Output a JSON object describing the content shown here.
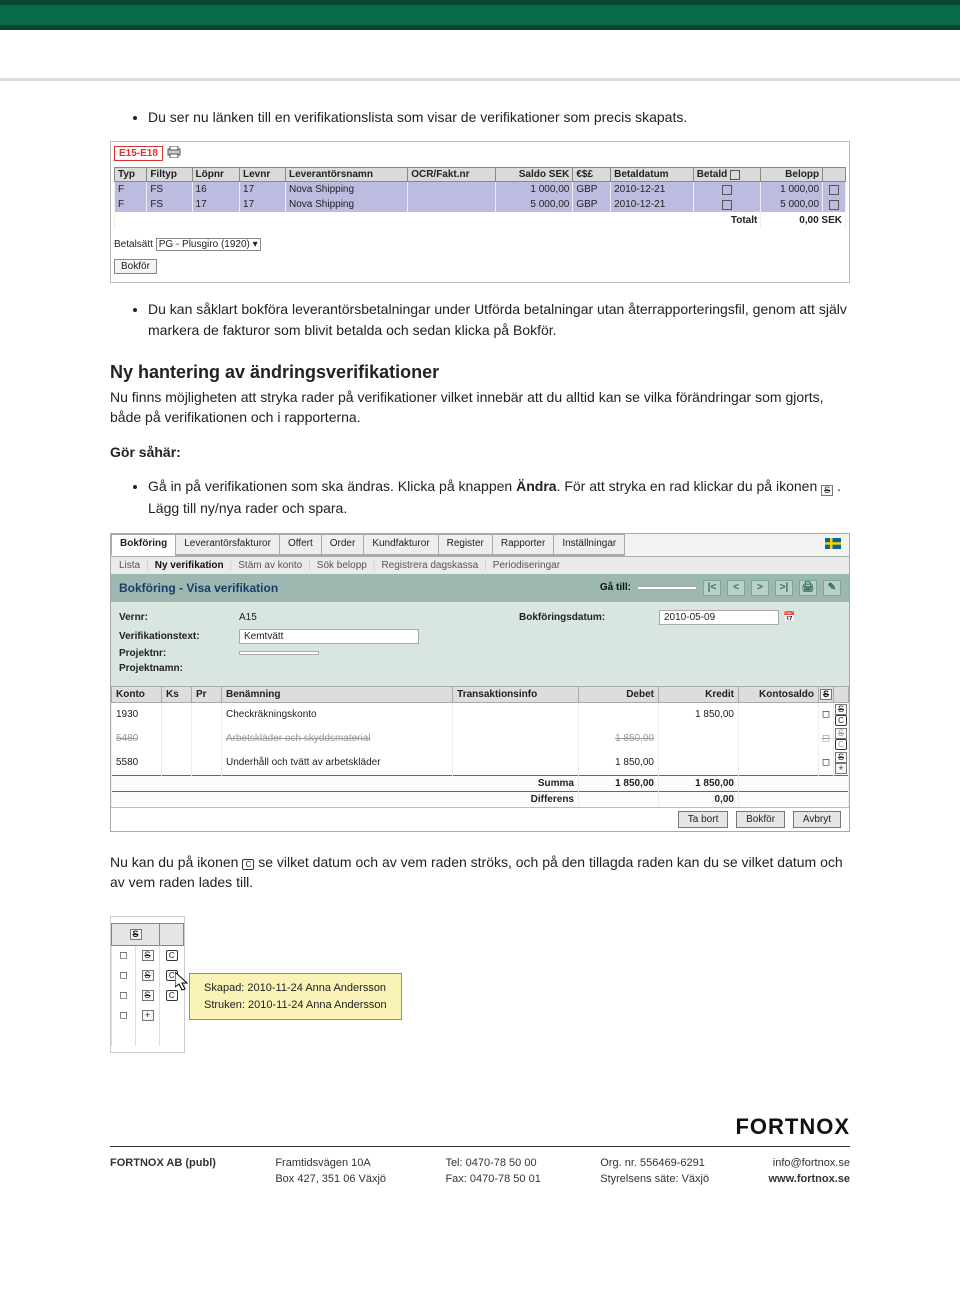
{
  "bullets": {
    "b1": "Du ser nu länken till en verifikationslista som visar de verifikationer som precis skapats.",
    "b2": "Du kan såklart bokföra leverantörsbetalningar under Utförda betalningar utan återrapporteringsfil, genom att själv markera de fakturor som blivit betalda och sedan klicka på Bokför."
  },
  "img1": {
    "link": "E15-E18",
    "headers": {
      "typ": "Typ",
      "filtyp": "Filtyp",
      "lopnr": "Löpnr",
      "levnr": "Levnr",
      "levnamn": "Leverantörsnamn",
      "ocr": "OCR/Fakt.nr",
      "saldo": "Saldo SEK",
      "cur": "€$£",
      "betdatum": "Betaldatum",
      "betald": "Betald",
      "belopp": "Belopp"
    },
    "rows": [
      {
        "typ": "F",
        "filtyp": "FS",
        "lopnr": "16",
        "levnr": "17",
        "levnamn": "Nova Shipping",
        "ocr": "",
        "saldo": "1 000,00",
        "cur": "GBP",
        "betdatum": "2010-12-21",
        "belopp": "1 000,00"
      },
      {
        "typ": "F",
        "filtyp": "FS",
        "lopnr": "17",
        "levnr": "17",
        "levnamn": "Nova Shipping",
        "ocr": "",
        "saldo": "5 000,00",
        "cur": "GBP",
        "betdatum": "2010-12-21",
        "belopp": "5 000,00"
      }
    ],
    "total": {
      "label": "Totalt",
      "value": "0,00  SEK"
    },
    "betalsatt_label": "Betalsätt",
    "betalsatt_value": "PG - Plusgiro (1920)",
    "bokfor_button": "Bokför"
  },
  "section": {
    "title": "Ny hantering av ändringsverifikationer",
    "body": "Nu finns möjligheten att stryka rader på verifikationer vilket innebär att du alltid kan se vilka förändringar som gjorts, både på verifikationen och i rapporterna.",
    "gor_sahar": "Gör såhär:",
    "b3_pre": "Gå in på verifikationen som ska ändras. Klicka på knappen ",
    "b3_bold": "Ändra",
    "b3_mid": ". För att stryka en rad klickar du på ikonen ",
    "b3_post": " . Lägg till ny/nya rader och spara."
  },
  "img2": {
    "tabs": [
      "Bokföring",
      "Leverantörsfakturor",
      "Offert",
      "Order",
      "Kundfakturor",
      "Register",
      "Rapporter",
      "Inställningar"
    ],
    "subtabs": [
      "Lista",
      "Ny verifikation",
      "Stäm av konto",
      "Sök belopp",
      "Registrera dagskassa",
      "Periodiseringar"
    ],
    "title": "Bokföring - Visa verifikation",
    "ga_till": "Gå till:",
    "labels": {
      "vernr": "Vernr:",
      "vertext": "Verifikationstext:",
      "projnr": "Projektnr:",
      "projnamn": "Projektnamn:",
      "bokdatum": "Bokföringsdatum:"
    },
    "values": {
      "vernr": "A15",
      "vertext": "Kemtvätt",
      "bokdatum": "2010-05-09"
    },
    "grid_headers": {
      "konto": "Konto",
      "ks": "Ks",
      "pr": "Pr",
      "ben": "Benämning",
      "trans": "Transaktionsinfo",
      "debet": "Debet",
      "kredit": "Kredit",
      "saldo": "Kontosaldo",
      "s": "S"
    },
    "grid_rows": [
      {
        "konto": "1930",
        "ben": "Checkräkningskonto",
        "debet": "",
        "kredit": "1 850,00"
      },
      {
        "konto": "5480",
        "ben": "Arbetskläder och skyddsmaterial",
        "debet": "1 850,00",
        "kredit": "",
        "struck": true
      },
      {
        "konto": "5580",
        "ben": "Underhåll och tvätt av arbetskläder",
        "debet": "1 850,00",
        "kredit": ""
      }
    ],
    "summa": {
      "label": "Summa",
      "debet": "1 850,00",
      "kredit": "1 850,00"
    },
    "differens": {
      "label": "Differens",
      "value": "0,00"
    },
    "buttons": {
      "tabort": "Ta bort",
      "bokfor": "Bokför",
      "avbryt": "Avbryt"
    }
  },
  "after2": {
    "pre": "Nu kan du på ikonen ",
    "post": " se vilket datum och av vem raden ströks, och på den tillagda raden kan du se vilket datum och av vem raden lades till."
  },
  "tooltip": {
    "line1": "Skapad:  2010-11-24  Anna Andersson",
    "line2": "Struken:  2010-11-24  Anna Andersson"
  },
  "footer": {
    "logo": "FORTNOX",
    "col1a": "FORTNOX AB (publ)",
    "col2a": "Framtidsvägen 10A",
    "col2b": "Box 427, 351 06 Växjö",
    "col3a": "Tel: 0470-78 50 00",
    "col3b": "Fax: 0470-78 50 01",
    "col4a": "Org. nr. 556469-6291",
    "col4b": "Styrelsens säte: Växjö",
    "col5a": "info@fortnox.se",
    "col5b": "www.fortnox.se"
  }
}
